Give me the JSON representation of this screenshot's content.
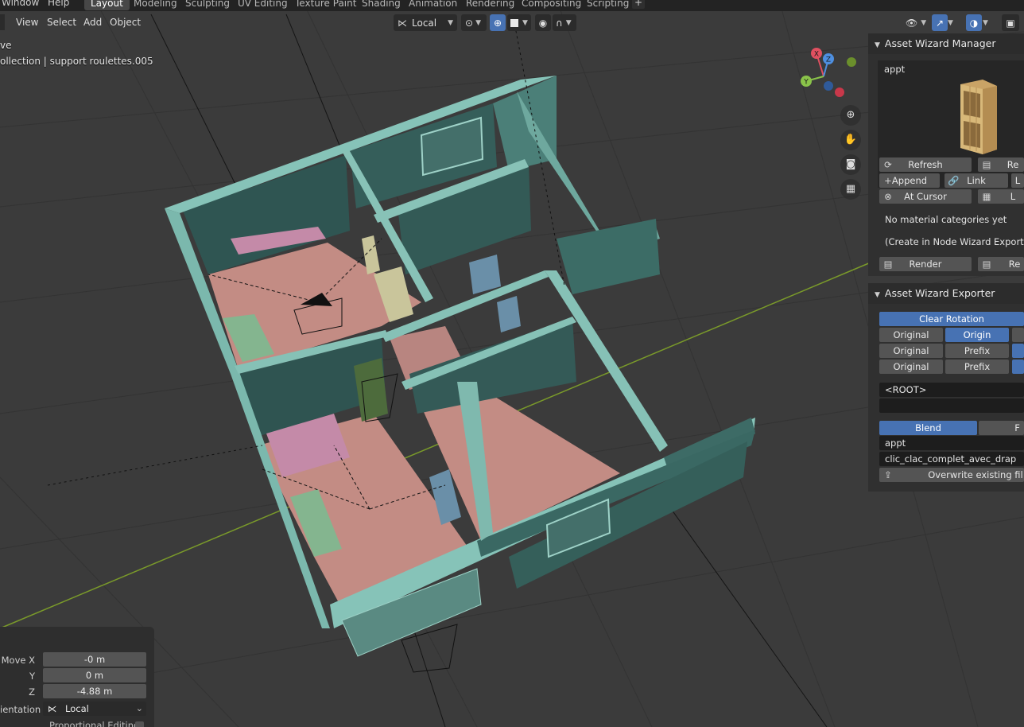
{
  "top_menu": {
    "window": "Window",
    "help": "Help"
  },
  "workspaces": [
    "Layout",
    "Modeling",
    "Sculpting",
    "UV Editing",
    "Texture Paint",
    "Shading",
    "Animation",
    "Rendering",
    "Compositing",
    "Scripting"
  ],
  "workspace_add": "+",
  "viewport_header": {
    "view": "View",
    "select": "Select",
    "add": "Add",
    "object": "Object",
    "transform_orientation": "Local"
  },
  "overlay_text": {
    "mode_fragment": "ve",
    "selection": "ollection | support roulettes.005"
  },
  "gizmo_axes": {
    "x": "X",
    "y": "Y",
    "z": "Z"
  },
  "asset_manager": {
    "title": "Asset Wizard Manager",
    "category": "appt",
    "refresh": "Refresh",
    "refresh_right": "Re",
    "append": "Append",
    "link": "Link",
    "link_right": "L",
    "at_cursor": "At Cursor",
    "at_cursor_right": "L",
    "no_materials": "No material categories yet",
    "create_hint": "(Create in Node Wizard Export)",
    "render": "Render",
    "render_right": "Re"
  },
  "asset_exporter": {
    "title": "Asset Wizard Exporter",
    "clear_rotation": "Clear Rotation",
    "rows": [
      [
        "Original",
        "Origin"
      ],
      [
        "Original",
        "Prefix"
      ],
      [
        "Original",
        "Prefix"
      ]
    ],
    "root": "<ROOT>",
    "blend": "Blend",
    "blend_right": "F",
    "category": "appt",
    "asset_name": "clic_clac_complet_avec_drap",
    "overwrite": "Overwrite existing fil"
  },
  "redo_panel": {
    "move_x_label": "Move X",
    "move_x": "-0 m",
    "y_label": "Y",
    "y": "0 m",
    "z_label": "Z",
    "z": "-4.88 m",
    "orientation_label": "ientation",
    "orientation": "Local",
    "proportional": "Proportional Editing"
  },
  "colors": {
    "accent": "#4772b3",
    "walls": "#5f9e94",
    "floor": "#c98f86"
  }
}
